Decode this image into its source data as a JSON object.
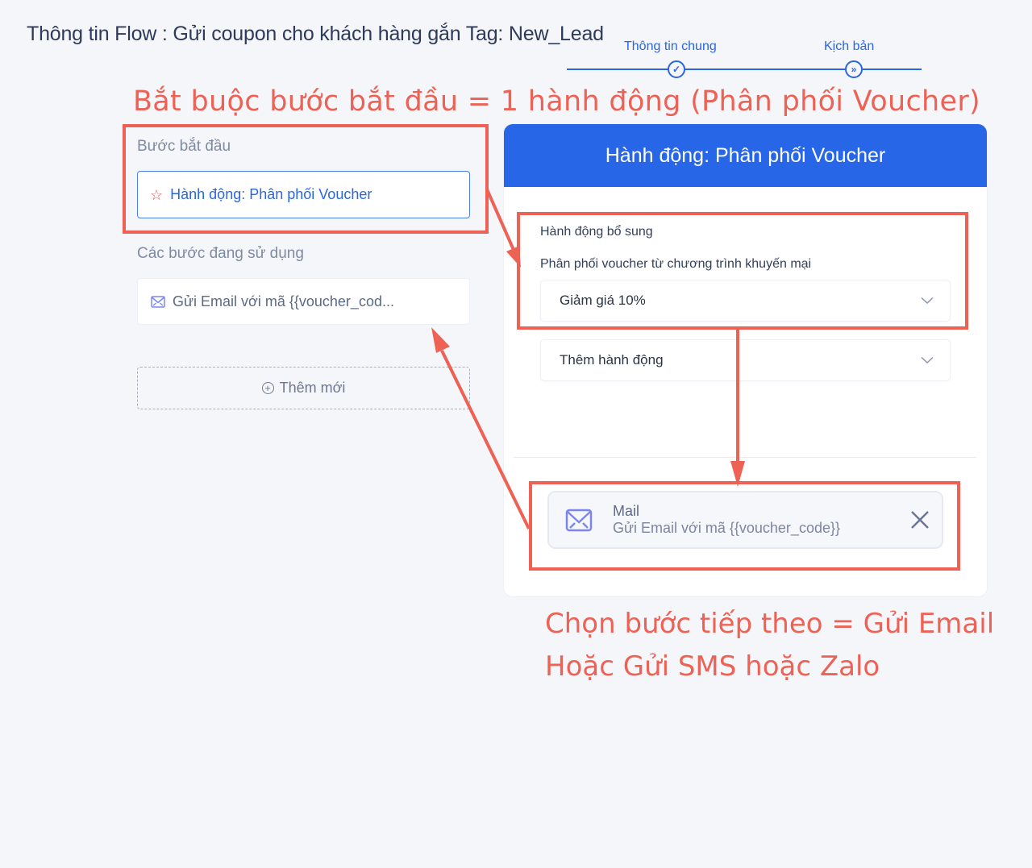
{
  "header": {
    "title": "Thông tin Flow : Gửi coupon cho khách hàng gắn Tag: New_Lead"
  },
  "stepper": {
    "steps": [
      {
        "label": "Thông tin chung",
        "icon": "check-icon",
        "glyph": "✓",
        "state": "completed"
      },
      {
        "label": "Kịch bản",
        "icon": "double-chevron-right-icon",
        "glyph": "»",
        "state": "current"
      }
    ],
    "color": "#2a66e0"
  },
  "annotations": {
    "top": "Bắt buộc bước bắt đầu = 1 hành động (Phân phối Voucher)",
    "bottom_line1": "Chọn bước tiếp theo = Gửi Email",
    "bottom_line2": "Hoặc Gửi SMS hoặc Zalo",
    "color": "#ee6155"
  },
  "left": {
    "start_label": "Bước bắt đầu",
    "start_step": {
      "icon": "star-icon",
      "glyph": "☆",
      "label": "Hành động: Phân phối Voucher"
    },
    "used_label": "Các bước đang sử dụng",
    "used_steps": [
      {
        "icon": "mail-icon",
        "label": "Gửi Email với mã {{voucher_cod..."
      }
    ],
    "add_new": {
      "icon": "plus-circle-icon",
      "glyph": "+",
      "label": "Thêm mới"
    }
  },
  "panel": {
    "title": "Hành động: Phân phối Voucher",
    "header_color": "#2766e6",
    "additional_actions_label": "Hành động bổ sung",
    "voucher_label": "Phân phối voucher từ chương trình khuyến mại",
    "voucher_select_value": "Giảm giá 10%",
    "add_action_select_value": "Thêm hành động",
    "next_step": {
      "icon": "mail-icon",
      "title": "Mail",
      "description": "Gửi Email với mã {{voucher_code}}",
      "close_icon": "close-icon"
    }
  }
}
